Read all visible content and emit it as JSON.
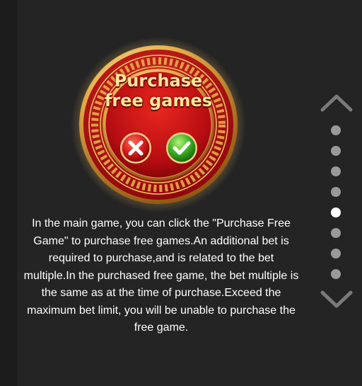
{
  "badge": {
    "title_line1": "Purchase",
    "title_line2": "free games",
    "cancel_icon": "close-icon",
    "confirm_icon": "check-icon"
  },
  "description": "In the main game, you can click the \"Purchase Free Game\" to purchase free games.An additional bet is required to purchase,and is related to the bet multiple.In the purchased free game, the bet multiple is the same as at the time of purchase.Exceed the maximum bet limit, you will be unable to purchase the free game.",
  "pager": {
    "up_icon": "chevron-up-icon",
    "down_icon": "chevron-down-icon",
    "total_pages": 8,
    "current_page": 5
  },
  "colors": {
    "background": "#242424",
    "text": "#ffffff",
    "badge_red": "#c8151c",
    "badge_gold": "#e8b04a",
    "dot_inactive": "#9a9a9a",
    "dot_active": "#ffffff",
    "arrow": "#7a7a7a"
  }
}
